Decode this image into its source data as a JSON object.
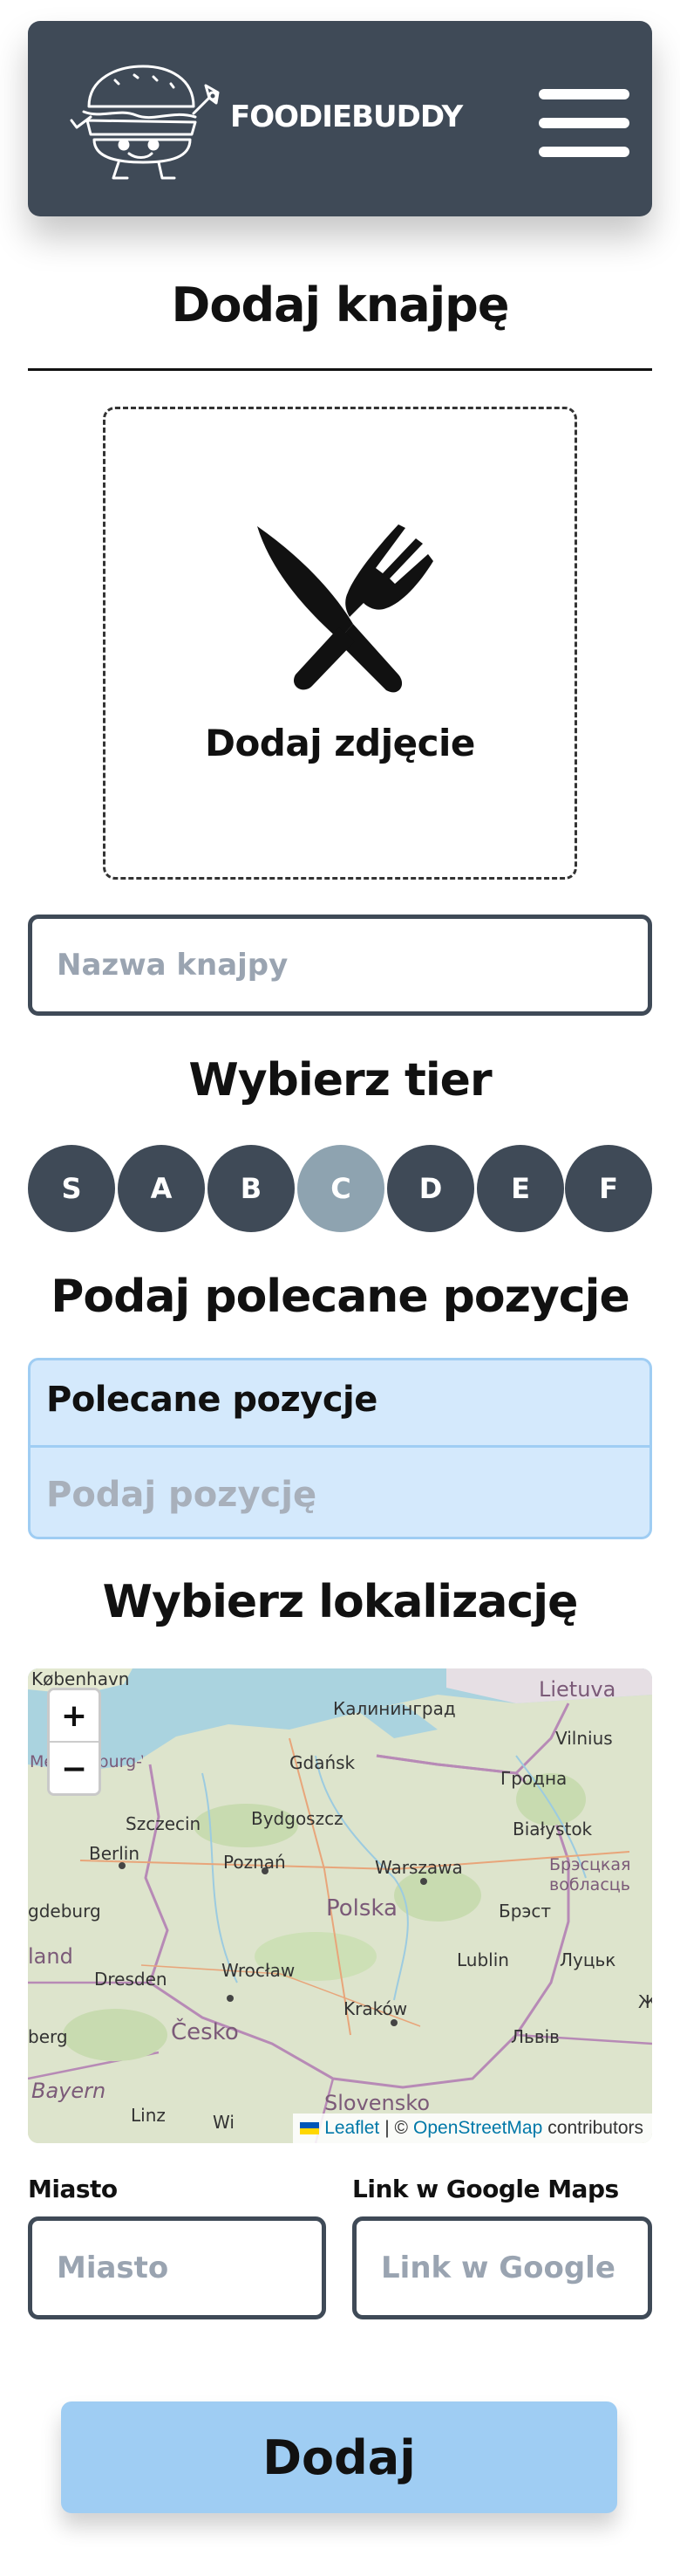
{
  "header": {
    "brand": "FOODIEBUDDY",
    "logo_icon": "burger-mascot-icon",
    "menu_icon": "hamburger-menu-icon",
    "background": "#3f4a57"
  },
  "page": {
    "title": "Dodaj knajpę"
  },
  "photo_upload": {
    "icon": "cutlery-icon",
    "label": "Dodaj zdjęcie"
  },
  "name_field": {
    "placeholder": "Nazwa knajpy",
    "value": ""
  },
  "tier_section": {
    "heading": "Wybierz tier",
    "options": [
      "S",
      "A",
      "B",
      "C",
      "D",
      "E",
      "F"
    ],
    "selected": "C",
    "color": "#3f4a57",
    "selected_color": "#8ea3b0"
  },
  "positions_section": {
    "heading": "Podaj polecane pozycje",
    "table_header": "Polecane pozycje",
    "input_placeholder": "Podaj pozycję"
  },
  "location_section": {
    "heading": "Wybierz lokalizację",
    "map": {
      "zoom_in": "+",
      "zoom_out": "−",
      "labels": {
        "kobenhavn": "København",
        "lietuva": "Lietuva",
        "kaliningrad": "Калининград",
        "vilnius": "Vilnius",
        "mecklenburg": "Mecklenburg-Vorpommern",
        "gdansk": "Gdańsk",
        "grodna": "Гродна",
        "szczecin": "Szczecin",
        "bydgoszcz": "Bydgoszcz",
        "bialystok": "Białystok",
        "berlin": "Berlin",
        "poznan": "Poznań",
        "warszawa": "Warszawa",
        "brest_region": "Брэсцкая вобласць",
        "magdeburg": "gdeburg",
        "polska": "Polska",
        "brest": "Брэст",
        "land": "land",
        "dresden": "Dresden",
        "wroclaw": "Wrocław",
        "lublin": "Lublin",
        "lutsk": "Луцьк",
        "zh": "Ж",
        "krakow": "Kraków",
        "berg": "berg",
        "cesko": "Česko",
        "lviv": "Львів",
        "bayern": "Bayern",
        "linz": "Linz",
        "wi": "Wi",
        "slovensko": "Slovensko"
      },
      "attribution": {
        "leaflet": "Leaflet",
        "separator": "| ©",
        "osm": "OpenStreetMap",
        "contributors": "contributors"
      }
    }
  },
  "city_field": {
    "label": "Miasto",
    "placeholder": "Miasto"
  },
  "link_field": {
    "label": "Link w Google Maps",
    "placeholder": "Link w Google"
  },
  "submit": {
    "label": "Dodaj",
    "color": "#9fcdf3"
  }
}
